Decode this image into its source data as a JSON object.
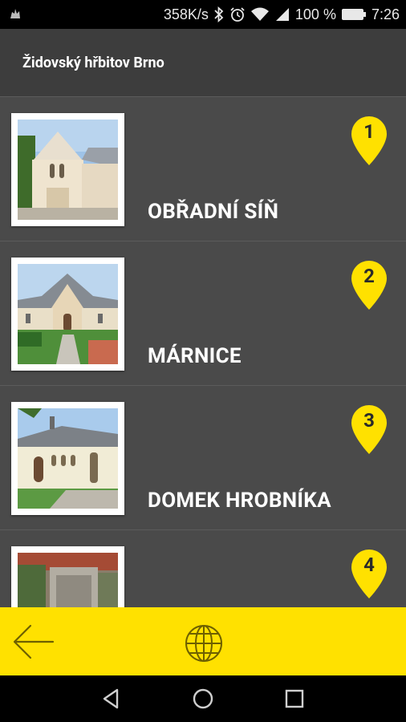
{
  "status_bar": {
    "speed": "358K/s",
    "battery": "100 %",
    "time": "7:26",
    "icons": [
      "app-notification-icon",
      "bluetooth-icon",
      "alarm-icon",
      "wifi-icon",
      "signal-icon",
      "battery-icon"
    ]
  },
  "header": {
    "title": "Židovský hřbitov Brno"
  },
  "items": [
    {
      "number": "1",
      "label": "OBŘADNÍ SÍŇ"
    },
    {
      "number": "2",
      "label": "MÁRNICE"
    },
    {
      "number": "3",
      "label": "DOMEK HROBNÍKA"
    },
    {
      "number": "4",
      "label": ""
    }
  ],
  "bottom_bar": {
    "icons": [
      "back-arrow-icon",
      "globe-icon"
    ]
  },
  "nav_bar": {
    "icons": [
      "nav-back-icon",
      "nav-home-icon",
      "nav-recents-icon"
    ]
  },
  "colors": {
    "accent": "#FFE100",
    "background": "#4A4A4A",
    "header": "#3D3D3D"
  }
}
